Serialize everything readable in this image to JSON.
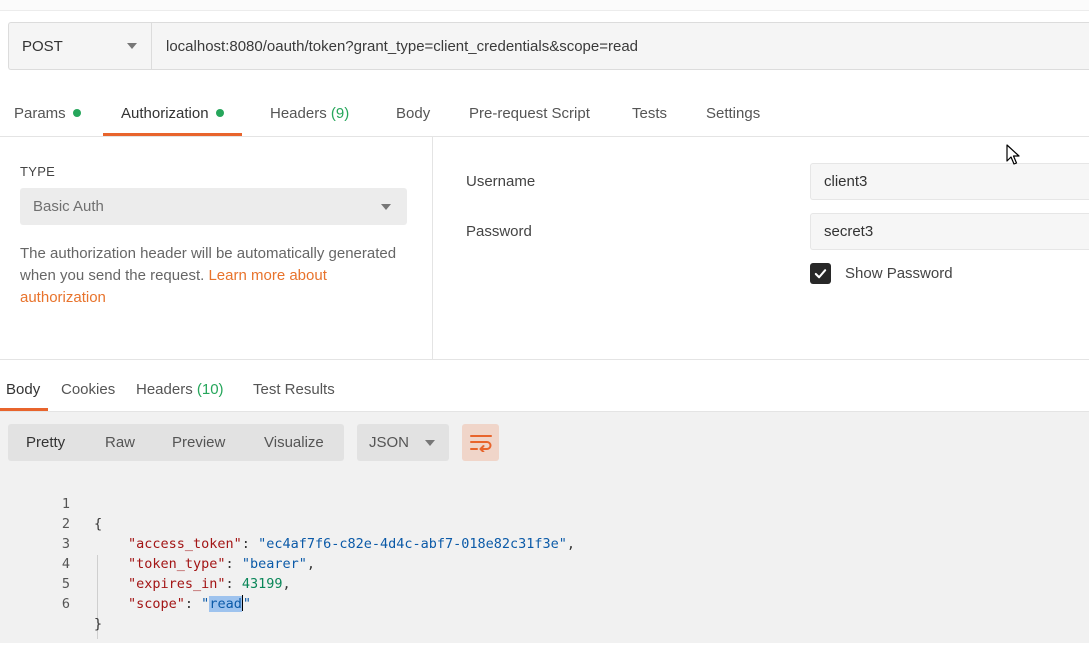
{
  "request": {
    "method": "POST",
    "url": "localhost:8080/oauth/token?grant_type=client_credentials&scope=read"
  },
  "request_tabs": [
    {
      "label": "Params",
      "dot": true
    },
    {
      "label": "Authorization",
      "dot": true,
      "active": true
    },
    {
      "label": "Headers",
      "count": "(9)"
    },
    {
      "label": "Body"
    },
    {
      "label": "Pre-request Script"
    },
    {
      "label": "Tests"
    },
    {
      "label": "Settings"
    }
  ],
  "auth": {
    "type_label": "TYPE",
    "type_value": "Basic Auth",
    "help_text": "The authorization header will be automatically generated when you send the request.",
    "help_link": "Learn more about authorization",
    "username_label": "Username",
    "username_value": "client3",
    "password_label": "Password",
    "password_value": "secret3",
    "show_password_label": "Show Password",
    "show_password_checked": true
  },
  "response_tabs": [
    {
      "label": "Body",
      "active": true
    },
    {
      "label": "Cookies"
    },
    {
      "label": "Headers",
      "count": "(10)"
    },
    {
      "label": "Test Results"
    }
  ],
  "format_buttons": [
    "Pretty",
    "Raw",
    "Preview",
    "Visualize"
  ],
  "format_active": "Pretty",
  "language": "JSON",
  "colors": {
    "accent": "#e8642c",
    "status_green": "#26a65b",
    "link": "#e8732c"
  },
  "response_body": {
    "line_numbers": [
      "1",
      "2",
      "3",
      "4",
      "5",
      "6"
    ],
    "open_brace": "{",
    "close_brace": "}",
    "entries": [
      {
        "key": "\"access_token\"",
        "value": "\"ec4af7f6-c82e-4d4c-abf7-018e82c31f3e\"",
        "type": "string"
      },
      {
        "key": "\"token_type\"",
        "value": "\"bearer\"",
        "type": "string"
      },
      {
        "key": "\"expires_in\"",
        "value": "43199",
        "type": "number"
      },
      {
        "key": "\"scope\"",
        "value": "read",
        "type": "string",
        "selected": true
      }
    ]
  }
}
